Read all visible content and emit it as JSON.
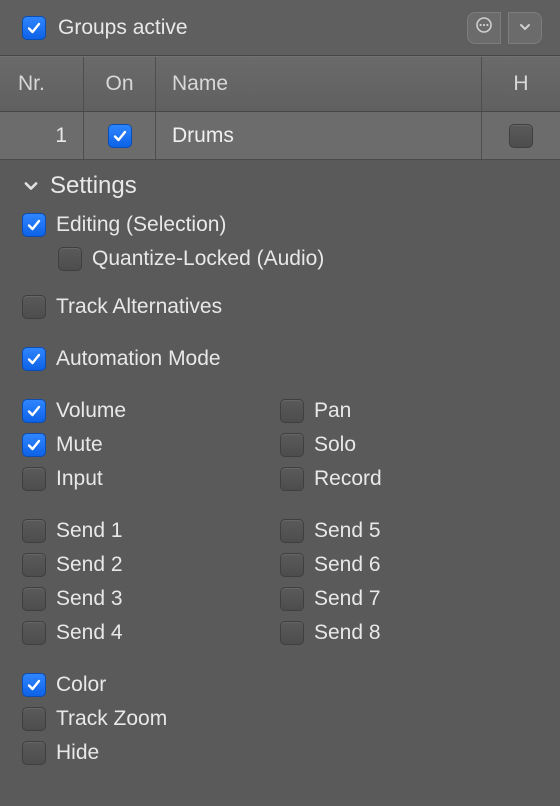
{
  "topbar": {
    "groups_active_label": "Groups active",
    "groups_active_checked": true
  },
  "columns": {
    "nr": "Nr.",
    "on": "On",
    "name": "Name",
    "h": "H"
  },
  "rows": [
    {
      "nr": "1",
      "on": true,
      "name": "Drums",
      "h": false
    }
  ],
  "settings": {
    "title": "Settings",
    "options": {
      "editing_selection": {
        "label": "Editing (Selection)",
        "checked": true
      },
      "quantize_locked": {
        "label": "Quantize-Locked (Audio)",
        "checked": false
      },
      "track_alternatives": {
        "label": "Track Alternatives",
        "checked": false
      },
      "automation_mode": {
        "label": "Automation Mode",
        "checked": true
      },
      "volume": {
        "label": "Volume",
        "checked": true
      },
      "pan": {
        "label": "Pan",
        "checked": false
      },
      "mute": {
        "label": "Mute",
        "checked": true
      },
      "solo": {
        "label": "Solo",
        "checked": false
      },
      "input": {
        "label": "Input",
        "checked": false
      },
      "record": {
        "label": "Record",
        "checked": false
      },
      "send1": {
        "label": "Send 1",
        "checked": false
      },
      "send5": {
        "label": "Send 5",
        "checked": false
      },
      "send2": {
        "label": "Send 2",
        "checked": false
      },
      "send6": {
        "label": "Send 6",
        "checked": false
      },
      "send3": {
        "label": "Send 3",
        "checked": false
      },
      "send7": {
        "label": "Send 7",
        "checked": false
      },
      "send4": {
        "label": "Send 4",
        "checked": false
      },
      "send8": {
        "label": "Send 8",
        "checked": false
      },
      "color": {
        "label": "Color",
        "checked": true
      },
      "track_zoom": {
        "label": "Track Zoom",
        "checked": false
      },
      "hide": {
        "label": "Hide",
        "checked": false
      }
    }
  }
}
